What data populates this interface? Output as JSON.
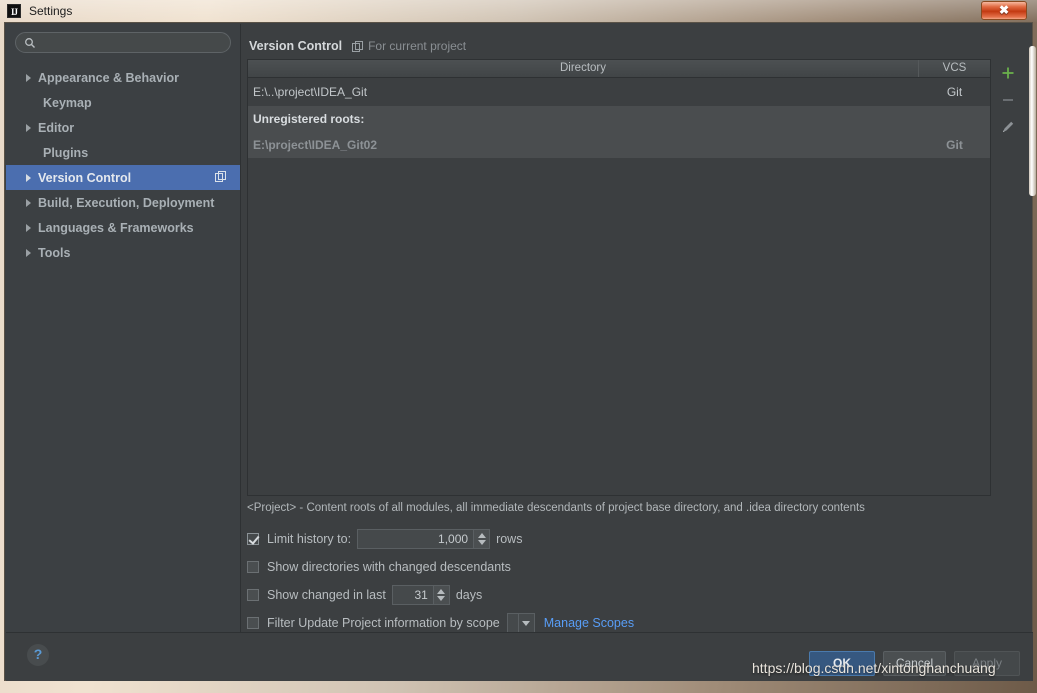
{
  "window": {
    "title": "Settings",
    "app_icon": "intellij-idea-logo",
    "close_label": "✕"
  },
  "sidebar": {
    "search": {
      "value": "",
      "placeholder": "",
      "icon": "search-icon"
    },
    "items": [
      {
        "label": "Appearance & Behavior",
        "expandable": true,
        "selected": false
      },
      {
        "label": "Keymap",
        "expandable": false,
        "selected": false
      },
      {
        "label": "Editor",
        "expandable": true,
        "selected": false
      },
      {
        "label": "Plugins",
        "expandable": false,
        "selected": false
      },
      {
        "label": "Version Control",
        "expandable": true,
        "selected": true,
        "badge_icon": "project-scope-icon"
      },
      {
        "label": "Build, Execution, Deployment",
        "expandable": true,
        "selected": false
      },
      {
        "label": "Languages & Frameworks",
        "expandable": true,
        "selected": false
      },
      {
        "label": "Tools",
        "expandable": true,
        "selected": false
      }
    ]
  },
  "content": {
    "title": "Version Control",
    "scope_icon": "project-scope-icon",
    "subtitle": "For current project",
    "table": {
      "columns": [
        "Directory",
        "VCS"
      ],
      "rows": [
        {
          "directory": "E:\\..\\project\\IDEA_Git",
          "vcs": "Git",
          "kind": "registered"
        },
        {
          "directory": "Unregistered roots:",
          "vcs": "",
          "kind": "group"
        },
        {
          "directory": "E:\\project\\IDEA_Git02",
          "vcs": "Git",
          "kind": "unregistered"
        }
      ]
    },
    "toolbar": [
      {
        "name": "add-root-button",
        "glyph": "plus-icon",
        "enabled": true
      },
      {
        "name": "remove-root-button",
        "glyph": "minus-icon",
        "enabled": false
      },
      {
        "name": "edit-root-button",
        "glyph": "pencil-icon",
        "enabled": true
      }
    ],
    "hint": "<Project> - Content roots of all modules, all immediate descendants of project base directory, and .idea directory contents",
    "options": {
      "limit_history": {
        "label": "Limit history to:",
        "checked": true,
        "value": "1,000",
        "suffix": "rows"
      },
      "show_changed_descendants": {
        "label": "Show directories with changed descendants",
        "checked": false
      },
      "show_changed_in_last": {
        "label": "Show changed in last",
        "checked": false,
        "value": "31",
        "suffix": "days"
      },
      "filter_by_scope": {
        "label": "Filter Update Project information by scope",
        "checked": false,
        "scope_value": "",
        "manage_link": "Manage Scopes"
      }
    }
  },
  "footer": {
    "help_label": "?",
    "ok_label": "OK",
    "cancel_label": "Cancel",
    "apply_label": "Apply",
    "watermark": "https://blog.csdn.net/xintonghanchuang"
  },
  "colors": {
    "selection_blue": "#4b6eaf",
    "ok_button_blue": "#365880",
    "link_blue": "#589df6",
    "panel_bg": "#3c3f41",
    "sidebar_bg": "#3c4043",
    "add_icon_green": "#6ab04c",
    "close_button_red": "#c33a12"
  }
}
